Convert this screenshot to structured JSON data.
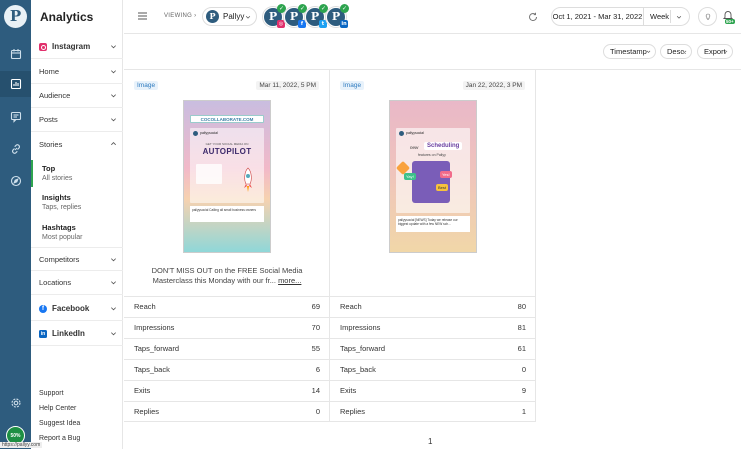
{
  "app": {
    "title": "Analytics"
  },
  "sidebar": {
    "network": "Instagram",
    "items": [
      "Home",
      "Audience",
      "Posts",
      "Stories"
    ],
    "stories_sub": [
      {
        "title": "Top",
        "subtitle": "All stories"
      },
      {
        "title": "Insights",
        "subtitle": "Taps, replies"
      },
      {
        "title": "Hashtags",
        "subtitle": "Most popular"
      }
    ],
    "more_items": [
      "Competitors",
      "Locations"
    ],
    "networks": [
      "Facebook",
      "LinkedIn"
    ],
    "footer": [
      "Support",
      "Help Center",
      "Suggest Idea",
      "Report a Bug"
    ]
  },
  "rail": {
    "avatar_text": "50%"
  },
  "topbar": {
    "viewing_label": "VIEWING",
    "account_name": "Pallyy",
    "profiles": [
      {
        "network": "instagram",
        "color": "#e1306c"
      },
      {
        "network": "facebook",
        "color": "#1877f2"
      },
      {
        "network": "twitter",
        "color": "#1da1f2"
      },
      {
        "network": "linkedin",
        "color": "#0a66c2"
      }
    ],
    "date_range": "Oct 1, 2021 - Mar 31, 2022",
    "interval": "Week",
    "notif_badge": "50+"
  },
  "toolbar": {
    "sort": "Timestamp",
    "order": "Desc.",
    "export": "Export"
  },
  "stories": [
    {
      "tag": "Image",
      "timestamp": "Mar 11, 2022, 5 PM",
      "caption": "DON'T MISS OUT on the FREE Social Media Masterclass this Monday with our fr...",
      "more": "more...",
      "thumb": {
        "link": "COCOLLABORATE.COM",
        "line1": "GET YOUR SOCIAL MEDIA ON",
        "headline": "AUTOPILOT",
        "handle": "pallyysocial",
        "post": "pallyysocial Calling all small business owners"
      },
      "metrics": [
        {
          "label": "Reach",
          "value": "69"
        },
        {
          "label": "Impressions",
          "value": "70"
        },
        {
          "label": "Taps_forward",
          "value": "55"
        },
        {
          "label": "Taps_back",
          "value": "6"
        },
        {
          "label": "Exits",
          "value": "14"
        },
        {
          "label": "Replies",
          "value": "0"
        }
      ]
    },
    {
      "tag": "Image",
      "timestamp": "Jan 22, 2022, 3 PM",
      "caption": "",
      "more": "",
      "thumb": {
        "handle": "pallyysocial",
        "line1": "new",
        "headline": "Scheduling",
        "line2": "features on Pallyy",
        "chip1": "Yay!",
        "chip2": "Yes!",
        "chip3": "Best",
        "post": "pallyysocial [NEWS] Today we release our biggest update with a few NEW sch..."
      },
      "metrics": [
        {
          "label": "Reach",
          "value": "80"
        },
        {
          "label": "Impressions",
          "value": "81"
        },
        {
          "label": "Taps_forward",
          "value": "61"
        },
        {
          "label": "Taps_back",
          "value": "0"
        },
        {
          "label": "Exits",
          "value": "9"
        },
        {
          "label": "Replies",
          "value": "1"
        }
      ]
    }
  ],
  "pager": {
    "page": "1"
  },
  "status_url": "https://pallyy.com"
}
